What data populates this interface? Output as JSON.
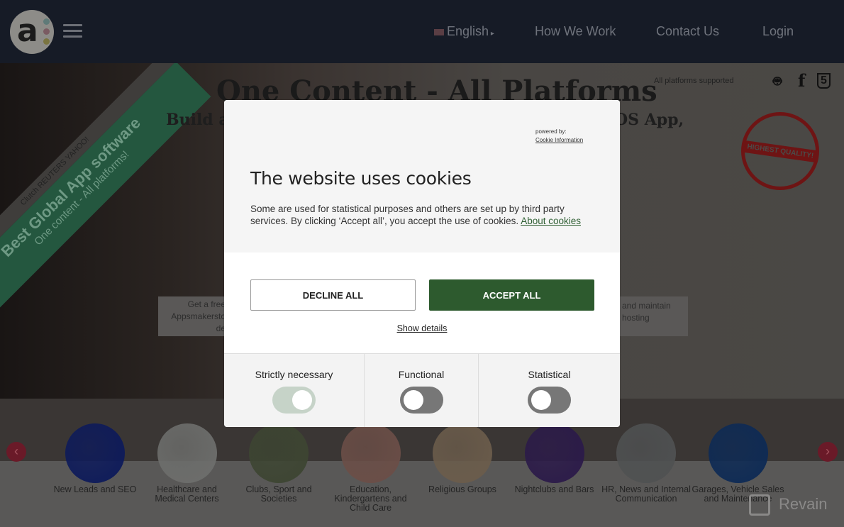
{
  "header": {
    "language": "English",
    "nav": [
      "How We Work",
      "Contact Us",
      "Login"
    ]
  },
  "hero": {
    "title": "One Content - All Platforms",
    "subtitle_left": "Build an",
    "subtitle_right": "OS App,",
    "platforms_label": "All platforms supported",
    "ribbon": {
      "logos": "Clutch  REUTERS  YAHOO!",
      "line1": "Best Global App software",
      "line2": "One content - All platforms!"
    },
    "stamp": "HIGHEST QUALITY!",
    "box_left": [
      "Get a free",
      "Appsmakersto",
      "de"
    ],
    "box_right": [
      "and maintain",
      "hosting"
    ]
  },
  "categories": [
    {
      "label": "New Leads and SEO",
      "color": "#0d1a5a"
    },
    {
      "label": "Healthcare and Medical Centers",
      "color": "#6d6e6c"
    },
    {
      "label": "Clubs, Sport and Societies",
      "color": "#3d4532"
    },
    {
      "label": "Education, Kindergartens and Child Care",
      "color": "#6b4e47"
    },
    {
      "label": "Religious Groups",
      "color": "#6b5c4b"
    },
    {
      "label": "Nightclubs and Bars",
      "color": "#2b1a49"
    },
    {
      "label": "HR, News and Internal Communication",
      "color": "#4f5152"
    },
    {
      "label": "Garages, Vehicle Sales and Maintenance",
      "color": "#0d2a55"
    }
  ],
  "watermark": "Revain",
  "cookie": {
    "powered_by": "powered by:",
    "provider": "Cookie Information",
    "title": "The website uses cookies",
    "text": "Some are used for statistical purposes and others are set up by third party services. By clicking ‘Accept all’, you accept the use of cookies.",
    "about_link": "About cookies",
    "decline": "DECLINE ALL",
    "accept": "ACCEPT ALL",
    "show_details": "Show details",
    "accent": "#2d5a2e",
    "toggles": [
      {
        "label": "Strictly necessary",
        "on": true,
        "disabled": true
      },
      {
        "label": "Functional",
        "on": false
      },
      {
        "label": "Statistical",
        "on": false
      }
    ]
  }
}
